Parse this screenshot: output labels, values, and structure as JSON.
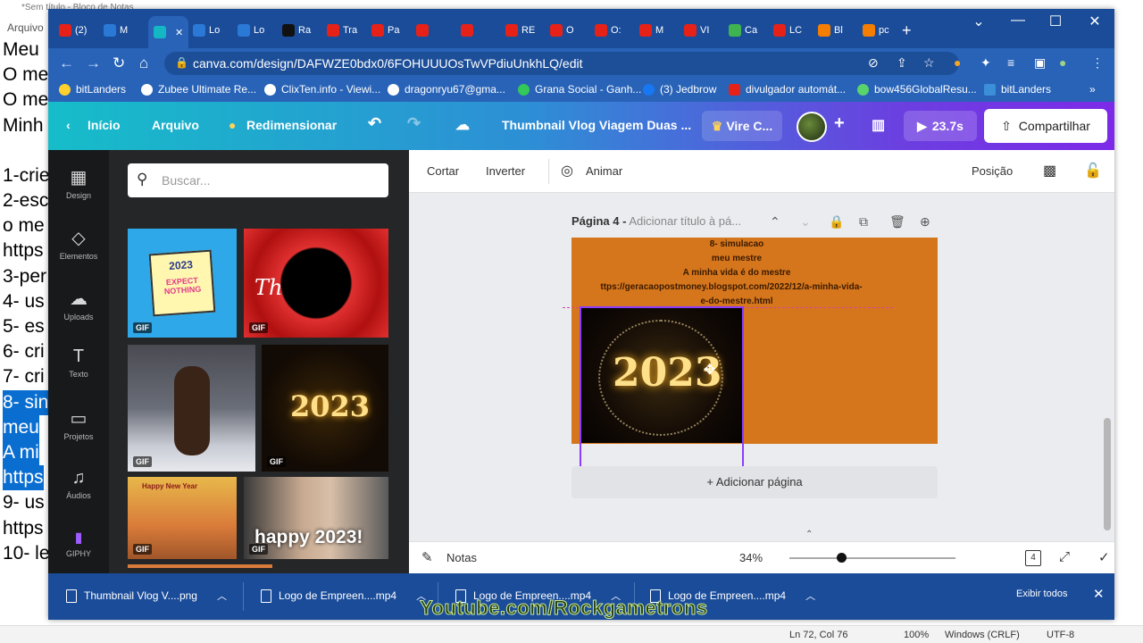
{
  "notepad": {
    "title": "*Sem título - Bloco de Notas",
    "menu": "Arquivo",
    "lines": [
      "Meu",
      "O me",
      "O me",
      "Minh",
      "",
      "1-crie",
      "2-esc",
      "o me",
      "https",
      "3-per",
      "4- us",
      "5- es",
      "6- cri",
      "7- cri",
      "8- sin",
      "meu",
      "A mi",
      "https",
      "9- us",
      "https",
      "10- le"
    ],
    "selected_lines": [
      14,
      15,
      16,
      17
    ],
    "status": {
      "position": "Ln 72, Col 76",
      "zoom": "100%",
      "eol": "Windows (CRLF)",
      "encoding": "UTF-8"
    }
  },
  "browser": {
    "tabs": [
      {
        "label": "(2)",
        "color": "#e62117",
        "icon": "youtube-icon"
      },
      {
        "label": "M",
        "color": "#2b79d6",
        "icon": "chrome-icon"
      },
      {
        "label": "",
        "color": "#14b8c4",
        "icon": "canva-icon",
        "active": true
      },
      {
        "label": "Lo",
        "color": "#2b79d6",
        "icon": "chrome-icon"
      },
      {
        "label": "Lo",
        "color": "#2b79d6",
        "icon": "chrome-icon"
      },
      {
        "label": "Ra",
        "color": "#111111",
        "icon": "r-icon"
      },
      {
        "label": "Tra",
        "color": "#e62117",
        "icon": "youtube-icon"
      },
      {
        "label": "Pa",
        "color": "#e62117",
        "icon": "youtube-icon"
      },
      {
        "label": "",
        "color": "#e62117",
        "icon": "youtube-audio-icon"
      },
      {
        "label": "",
        "color": "#e62117",
        "icon": "youtube-audio-icon"
      },
      {
        "label": "RE",
        "color": "#e62117",
        "icon": "youtube-icon"
      },
      {
        "label": "O",
        "color": "#e62117",
        "icon": "youtube-icon"
      },
      {
        "label": "O:",
        "color": "#e62117",
        "icon": "youtube-icon"
      },
      {
        "label": "M",
        "color": "#e62117",
        "icon": "youtube-icon"
      },
      {
        "label": "VI",
        "color": "#e62117",
        "icon": "youtube-icon"
      },
      {
        "label": "Ca",
        "color": "#3fb34f",
        "icon": "pinwheel-icon"
      },
      {
        "label": "LC",
        "color": "#e62117",
        "icon": "youtube-icon"
      },
      {
        "label": "Bl",
        "color": "#f57d00",
        "icon": "blogger-icon"
      },
      {
        "label": "pc",
        "color": "#f57d00",
        "icon": "blogger-icon"
      }
    ],
    "url": "canva.com/design/DAFWZE0bdx0/6FOHUUUOsTwVPdiuUnkhLQ/edit",
    "bookmarks": [
      "bitLanders",
      "Zubee Ultimate Re...",
      "ClixTen.info - Viewi...",
      "dragonryu67@gma...",
      "Grana Social - Ganh...",
      "(3) Jedbrow",
      "divulgador automát...",
      "bow456GlobalResu...",
      "bitLanders"
    ]
  },
  "canva": {
    "top": {
      "home": "Início",
      "file": "Arquivo",
      "resize": "Redimensionar",
      "doc_title": "Thumbnail Vlog Viagem Duas ...",
      "upgrade": "Vire C...",
      "play_time": "23.7s",
      "share": "Compartilhar"
    },
    "sidebar": [
      "Design",
      "Elementos",
      "Uploads",
      "Texto",
      "Projetos",
      "Áudios",
      "GIPHY"
    ],
    "search_placeholder": "Buscar...",
    "gif_badge": "GIF",
    "gifs": [
      {
        "name": "expect-nothing-gif",
        "text1": "2023",
        "text2": "EXPECT NOTHING"
      },
      {
        "name": "looney-tunes-gif",
        "text1": "Th"
      },
      {
        "name": "wrestler-gif"
      },
      {
        "name": "fireworks-2023-gif",
        "text1": "2023"
      },
      {
        "name": "peanuts-gif",
        "text1": "Happy New Year"
      },
      {
        "name": "happy-2023-gif",
        "text1": "happy 2023!"
      }
    ],
    "context": {
      "cut": "Cortar",
      "invert": "Inverter",
      "animate": "Animar",
      "position": "Posição"
    },
    "page_label": "Página 4 -",
    "page_title_placeholder": "Adicionar título à pá...",
    "page_text": [
      "8- simulacao",
      "meu mestre",
      "A minha vida é do mestre",
      "ttps://geracaopostmoney.blogspot.com/2022/12/a-minha-vida-",
      "e-do-mestre.html"
    ],
    "video_text": "2023",
    "add_page": "+ Adicionar página",
    "notes": "Notas",
    "zoom": "34%",
    "zoom_fraction": 0.31,
    "page_count": "4",
    "page_bg": "#d5761c",
    "accent": "#8b3dff"
  },
  "downloads": {
    "items": [
      "Thumbnail Vlog V....png",
      "Logo de Empreen....mp4",
      "Logo de Empreen....mp4",
      "Logo de Empreen....mp4"
    ],
    "show_all": "Exibir todos"
  },
  "watermark": "Youtube.com/Rockgametrons"
}
